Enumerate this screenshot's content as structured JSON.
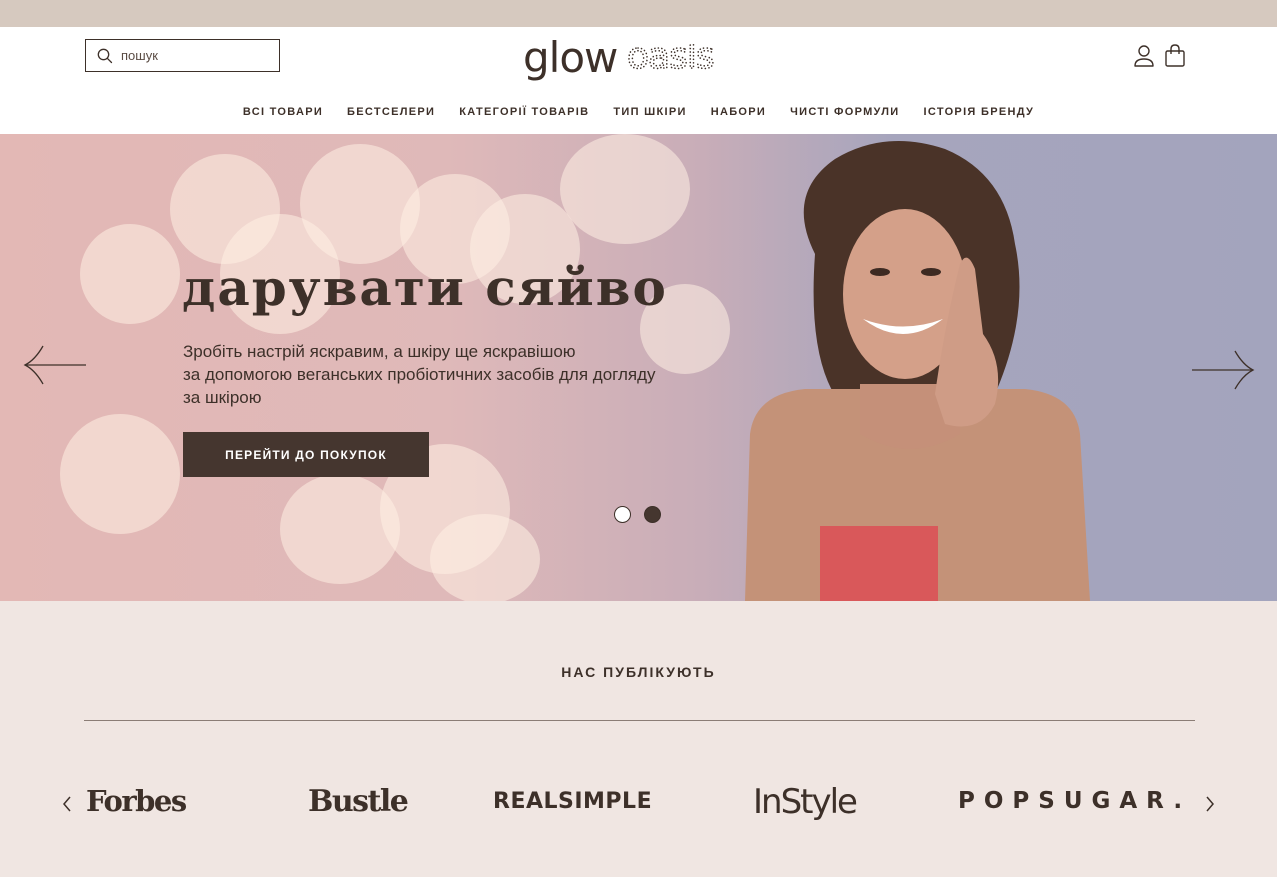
{
  "colors": {
    "topbar": "#d6c9bf",
    "text_dark": "#3d3029",
    "button_bg": "#45362f",
    "press_bg": "#f0e6e2"
  },
  "header": {
    "search": {
      "placeholder": "пошук",
      "icon": "search-icon"
    },
    "logo": {
      "text_main": "glow",
      "text_dotted": "oasis"
    },
    "icons": [
      "user-icon",
      "shopping-bag-icon"
    ]
  },
  "nav": {
    "items": [
      {
        "label": "ВСІ ТОВАРИ"
      },
      {
        "label": "БЕСТСЕЛЕРИ"
      },
      {
        "label": "КАТЕГОРІЇ ТОВАРІВ"
      },
      {
        "label": "ТИП ШКІРИ"
      },
      {
        "label": "НАБОРИ"
      },
      {
        "label": "ЧИСТІ ФОРМУЛИ"
      },
      {
        "label": "ІСТОРІЯ БРЕНДУ"
      }
    ]
  },
  "hero": {
    "title": "дарувати сяйво",
    "description_lines": [
      "Зробіть настрій яскравим, а шкіру ще яскравішою",
      "за допомогою веганських пробіотичних засобів для догляду",
      "за шкірою"
    ],
    "cta_label": "ПЕРЕЙТИ ДО ПОКУПОК",
    "slides_total": 2,
    "active_slide": 2,
    "arrows": [
      "arrow-left-icon",
      "arrow-right-icon"
    ]
  },
  "press": {
    "title": "НАС ПУБЛІКУЮТЬ",
    "brands": [
      "Forbes",
      "Bustle",
      "REALSIMPLE",
      "InStyle",
      "POPSUGAR."
    ],
    "arrows": [
      "chevron-left-icon",
      "chevron-right-icon"
    ]
  }
}
